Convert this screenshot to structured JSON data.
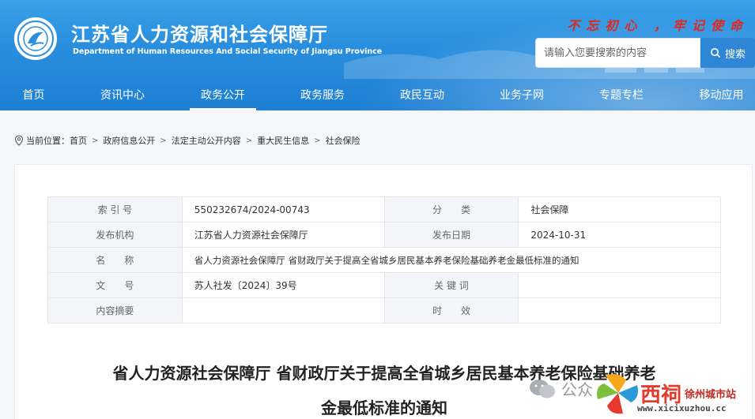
{
  "site": {
    "title": "江苏省人力资源和社会保障厅",
    "subtitle": "Department of Human Resources And Social Security of Jiangsu Province",
    "slogan": "不忘初心 ，牢记使命"
  },
  "search": {
    "placeholder": "请输入您要搜索的内容",
    "button_label": "搜索"
  },
  "nav": {
    "items": [
      {
        "label": "首页"
      },
      {
        "label": "资讯中心"
      },
      {
        "label": "政务公开"
      },
      {
        "label": "政务服务"
      },
      {
        "label": "政民互动"
      },
      {
        "label": "业务子网"
      },
      {
        "label": "专题专栏"
      },
      {
        "label": "移动应用"
      }
    ],
    "active": "政务公开"
  },
  "breadcrumb": {
    "prefix": "当前位置：",
    "items": [
      "首页",
      "政府信息公开",
      "法定主动公开内容",
      "重大民生信息",
      "社会保险"
    ]
  },
  "meta": {
    "index_label": "索 引 号",
    "index_value": "550232674/2024-00743",
    "category_label": "分　　类",
    "category_value": "社会保障",
    "org_label": "发布机构",
    "org_value": "江苏省人力资源社会保障厅",
    "date_label": "发布日期",
    "date_value": "2024-10-31",
    "name_label": "名　　称",
    "name_value": "省人力资源社会保障厅 省财政厅关于提高全省城乡居民基本养老保险基础养老金最低标准的通知",
    "doc_label": "文　　号",
    "doc_value": "苏人社发〔2024〕39号",
    "keywords_label": "关 键 词",
    "keywords_value": "",
    "summary_label": "内容摘要",
    "summary_value": "",
    "validity_label": "时　　效",
    "validity_value": ""
  },
  "article": {
    "title_line1": "省人力资源社会保障厅 省财政厅关于提高全省城乡居民基本养老保险基础养老",
    "title_line2": "金最低标准的通知"
  },
  "watermark": {
    "wechat_text": "公众",
    "brand_text": "西祠",
    "brand_sub": "徐州城市站",
    "url": "www.xicixuzhou.cc"
  },
  "colors": {
    "header_blue": "#2a8fde",
    "slogan_red": "#e3271d",
    "search_button": "#2f86d6"
  }
}
